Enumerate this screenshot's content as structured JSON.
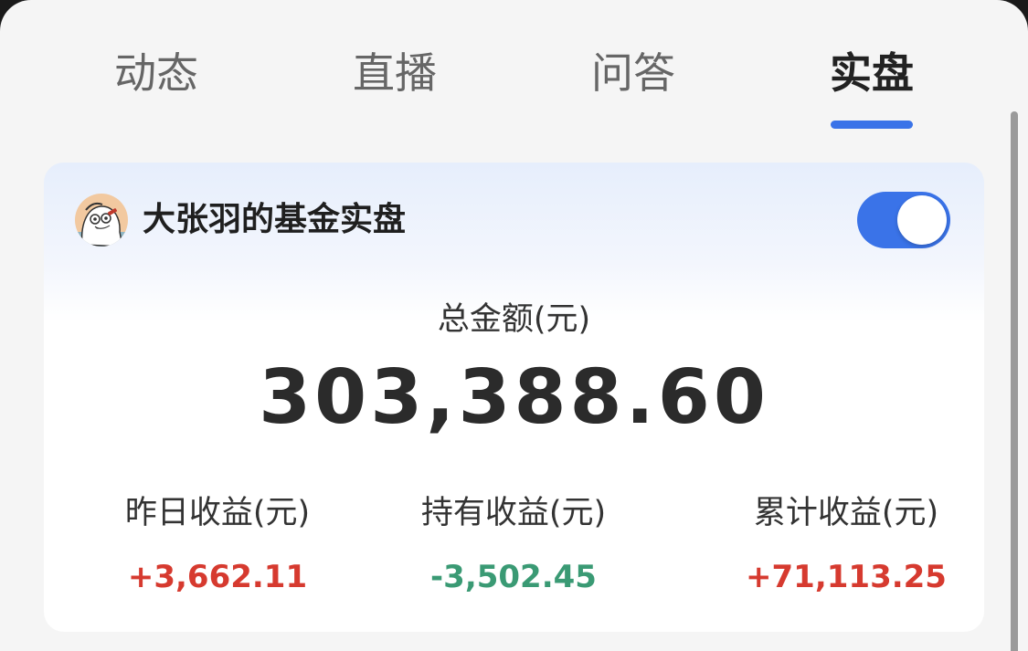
{
  "tabs": [
    {
      "label": "动态",
      "active": false
    },
    {
      "label": "直播",
      "active": false
    },
    {
      "label": "问答",
      "active": false
    },
    {
      "label": "实盘",
      "active": true
    }
  ],
  "card": {
    "title": "大张羽的基金实盘",
    "avatar_icon": "cartoon-duck-avatar",
    "toggle_on": true,
    "total_label": "总金额(元)",
    "total_value": "303,388.60",
    "stats": [
      {
        "label": "昨日收益(元)",
        "value": "+3,662.11",
        "trend": "positive"
      },
      {
        "label": "持有收益(元)",
        "value": "-3,502.45",
        "trend": "negative"
      },
      {
        "label": "累计收益(元)",
        "value": "+71,113.25",
        "trend": "positive"
      }
    ]
  },
  "colors": {
    "accent": "#3a73e8",
    "positive": "#d63a2f",
    "negative": "#3a9a74"
  }
}
